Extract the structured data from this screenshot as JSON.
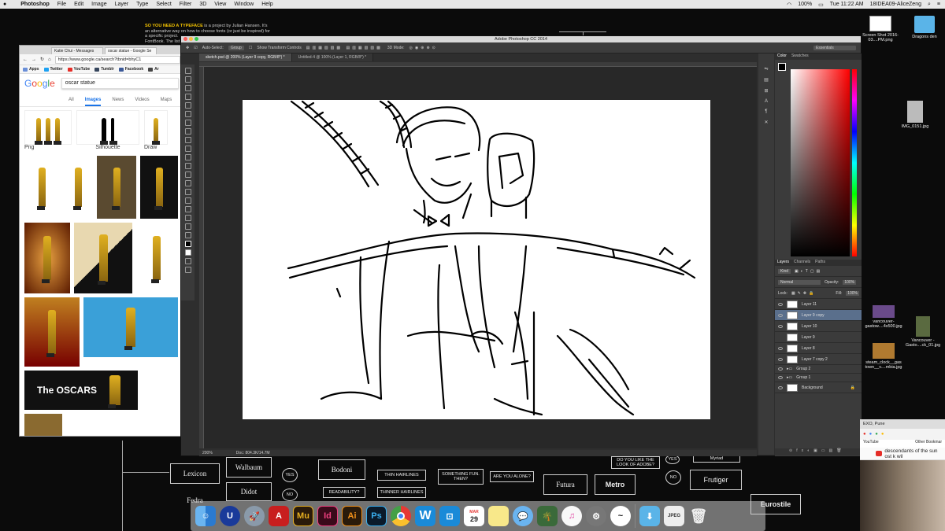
{
  "menubar": {
    "app": "Photoshop",
    "items": [
      "File",
      "Edit",
      "Image",
      "Layer",
      "Type",
      "Select",
      "Filter",
      "3D",
      "View",
      "Window",
      "Help"
    ],
    "battery": "100%",
    "datetime": "Tue 11:22 AM",
    "user": "18IDEA09-AliceZeng"
  },
  "wallpaper": {
    "intro_highlight": "SO YOU NEED A TYPEFACE",
    "intro_text": " is a project by Julian Hansen. It's an alternative way on how to choose fonts (or just be inspired) for a specific project.",
    "intro_credit": "FontBook. The list ...",
    "fonts": [
      "Lexicon",
      "Walbaum",
      "Bodoni",
      "Didot",
      "Fedra",
      "Futura",
      "Metro",
      "Frutiger",
      "Eurostile",
      "Myriad"
    ],
    "questions": [
      "THIN HAIRLINES",
      "SOMETHING FUN. THEN?",
      "ARE YOU ALONE?",
      "READABILITY?",
      "THINNER HAIRLINES",
      "DO YOU LIKE THE LOOK OF ADOBE?"
    ],
    "answers": [
      "YES",
      "NO",
      "YES",
      "NO"
    ]
  },
  "chrome": {
    "tabs": [
      "Katie Chui - Messages",
      "oscar statue - Google Se"
    ],
    "url": "https://www.google.ca/search?tbnid=bhyC1",
    "bookmarks": [
      "Apps",
      "Twitter",
      "YouTube",
      "Tumblr",
      "Facebook",
      "Ar"
    ],
    "search_query": "oscar statue",
    "search_tabs": [
      "All",
      "Images",
      "News",
      "Videos",
      "Maps"
    ],
    "active_tab": "Images",
    "related": [
      "Png",
      "Silhouette",
      "Draw"
    ],
    "oscars_tile": "The OSCARS"
  },
  "photoshop": {
    "window_title": "Adobe Photoshop CC 2014",
    "tool_label": "Auto-Select:",
    "tool_select": "Group",
    "transform_label": "Show Transform Controls",
    "mode_3d": "3D Mode:",
    "workspace": "Essentials",
    "docs": [
      "sketch.psd @ 200% (Layer 9 copy, RGB/8*) *",
      "Untitled-4 @ 100% (Layer 1, RGB/8*) *"
    ],
    "zoom": "200%",
    "doc_size": "Doc: 804.3K/14.7M",
    "color_tabs": [
      "Color",
      "Swatches"
    ],
    "layer_tabs": [
      "Layers",
      "Channels",
      "Paths"
    ],
    "kind": "Kind",
    "blend": "Normal",
    "opacity_label": "Opacity:",
    "opacity": "100%",
    "lock_label": "Lock:",
    "fill_label": "Fill:",
    "fill": "100%",
    "layers": [
      "Layer 11",
      "Layer 9 copy",
      "Layer 10",
      "Layer 9",
      "Layer 8",
      "Layer 7 copy 2",
      "Group 2",
      "Group 1",
      "Background"
    ],
    "selected_layer": "Layer 9 copy"
  },
  "desktop": {
    "icons": [
      "Screen Shot 2016-03....PM.png",
      "Dragons den",
      "IMG_0151.jpg",
      "vancouver-gastow....4x500.jpg",
      "Vancouver - Gasto....ck_01.jpg",
      "steam_clock__gas town__v....mbia.jpg"
    ]
  },
  "chrome2": {
    "tab": "EXO, Pune",
    "bookmark": "Other Bookmar",
    "youtube": "YouTube",
    "search": "descendants of the sun ost k wil"
  },
  "dock": {
    "items": [
      "Finder",
      "Uplay",
      "Launchpad",
      "Acrobat",
      "Mu",
      "Id",
      "Ai",
      "Ps",
      "Chrome",
      "W",
      "Capture",
      "Calendar",
      "Notes",
      "Messages",
      "Photos",
      "iTunes",
      "System Preferences",
      "Notational",
      "Downloads",
      "Preview",
      "Trash"
    ],
    "calendar_month": "MAR",
    "calendar_day": "29"
  },
  "colors": {
    "ps_bg": "#2e2e2e",
    "selected_layer": "#5a6f8c",
    "accent": "#1a73e8"
  }
}
